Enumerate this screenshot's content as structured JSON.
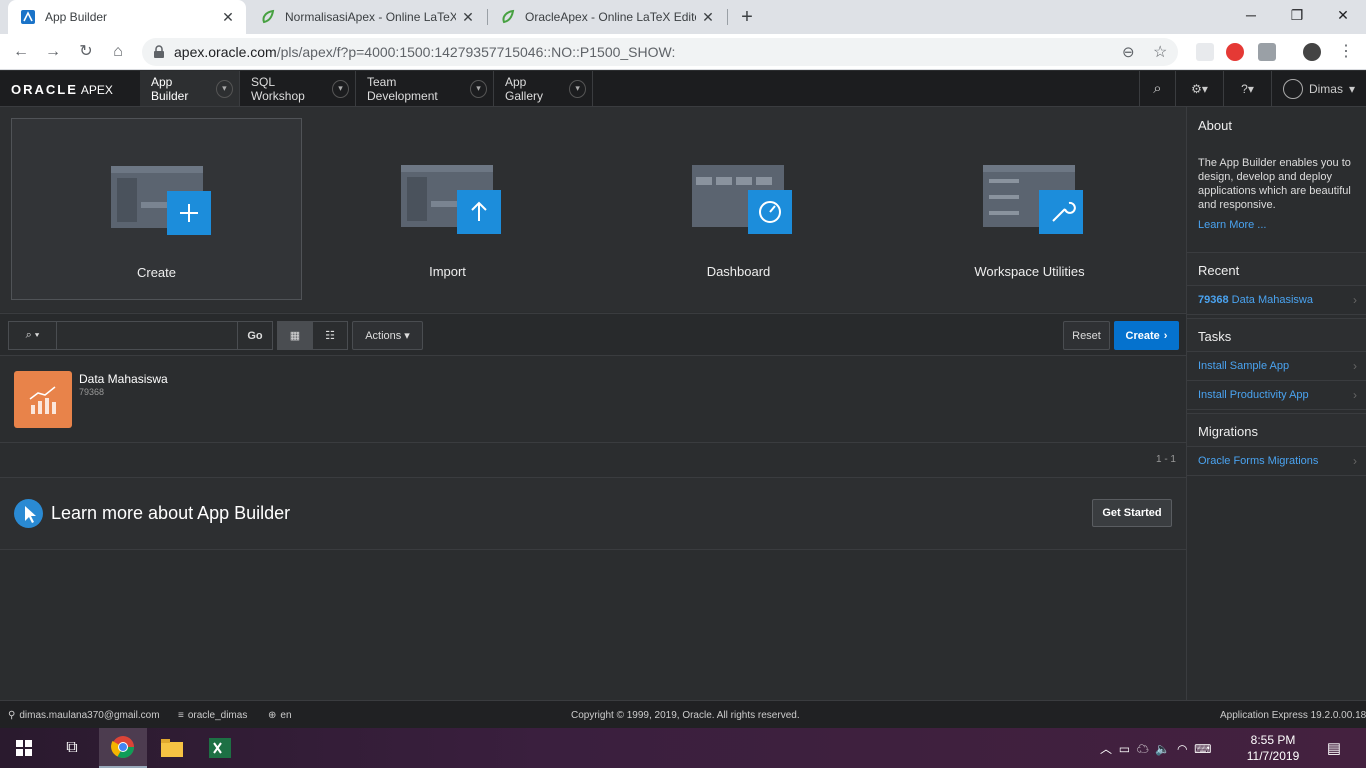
{
  "browser": {
    "tabs": [
      {
        "title": "App Builder",
        "active": true
      },
      {
        "title": "NormalisasiApex - Online LaTeX E",
        "active": false
      },
      {
        "title": "OracleApex - Online LaTeX Editor",
        "active": false
      }
    ],
    "url_host": "apex.oracle.com",
    "url_path": "/pls/apex/f?p=4000:1500:14279357715046::NO::P1500_SHOW:"
  },
  "apex": {
    "logo_main": "ORACLE",
    "logo_sub": "APEX",
    "nav": [
      "App Builder",
      "SQL Workshop",
      "Team Development",
      "App Gallery"
    ],
    "user": "Dimas"
  },
  "hero": {
    "cards": [
      "Create",
      "Import",
      "Dashboard",
      "Workspace Utilities"
    ]
  },
  "toolbar": {
    "go": "Go",
    "actions": "Actions",
    "reset": "Reset",
    "create": "Create"
  },
  "apps": [
    {
      "name": "Data Mahasiswa",
      "id": "79368"
    }
  ],
  "pager": "1 - 1",
  "learn": {
    "title": "Learn more about App Builder",
    "button": "Get Started"
  },
  "side": {
    "about_title": "About",
    "about_text": "The App Builder enables you to design, develop and deploy applications which are beautiful and responsive.",
    "learn_more": "Learn More ...",
    "recent_title": "Recent",
    "recent_id": "79368",
    "recent_name": "Data Mahasiswa",
    "tasks_title": "Tasks",
    "tasks": [
      "Install Sample App",
      "Install Productivity App"
    ],
    "migrations_title": "Migrations",
    "migrations": [
      "Oracle Forms Migrations"
    ]
  },
  "footer": {
    "email": "dimas.maulana370@gmail.com",
    "schema": "oracle_dimas",
    "lang": "en",
    "copyright": "Copyright © 1999, 2019, Oracle. All rights reserved.",
    "version": "Application Express 19.2.0.00.18"
  },
  "taskbar": {
    "time": "8:55 PM",
    "date": "11/7/2019"
  },
  "colors": {
    "accent": "#0572ce",
    "app_icon": "#e8834a"
  }
}
